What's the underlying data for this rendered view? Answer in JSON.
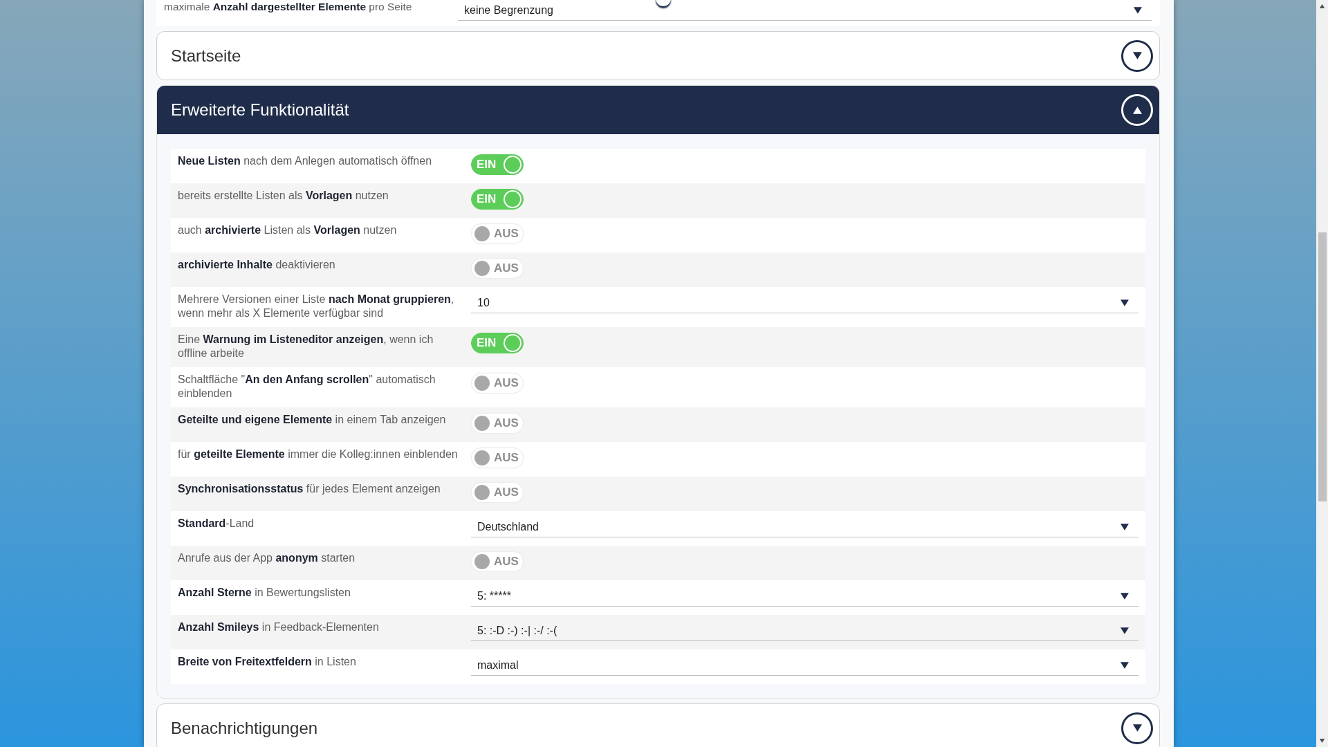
{
  "top_row": {
    "label": "maximale **Anzahl dargestellter Elemente** pro Seite",
    "value": "keine Begrenzung"
  },
  "sections": [
    {
      "title": "Startseite",
      "expanded": false
    },
    {
      "title": "Erweiterte Funktionalität",
      "expanded": true,
      "settings": [
        {
          "kind": "toggle",
          "label": "**Neue Listen** nach dem Anlegen automatisch öffnen",
          "on": true,
          "state_label": "EIN"
        },
        {
          "kind": "toggle",
          "label": "bereits erstellte Listen als **Vorlagen** nutzen",
          "on": true,
          "state_label": "EIN"
        },
        {
          "kind": "toggle",
          "label": "auch **archivierte** Listen als **Vorlagen** nutzen",
          "on": false,
          "state_label": "AUS"
        },
        {
          "kind": "toggle",
          "label": "**archivierte Inhalte** deaktivieren",
          "on": false,
          "state_label": "AUS"
        },
        {
          "kind": "select",
          "label": "Mehrere Versionen einer Liste **nach Monat gruppieren**, wenn mehr als X Elemente verfügbar sind",
          "value": "10"
        },
        {
          "kind": "toggle",
          "label": "Eine **Warnung im Listeneditor anzeigen**, wenn ich offline arbeite",
          "on": true,
          "state_label": "EIN"
        },
        {
          "kind": "toggle",
          "label": "Schaltfläche \"**An den Anfang scrollen**\" automatisch einblenden",
          "on": false,
          "state_label": "AUS"
        },
        {
          "kind": "toggle",
          "label": "**Geteilte und eigene Elemente** in einem Tab anzeigen",
          "on": false,
          "state_label": "AUS"
        },
        {
          "kind": "toggle",
          "label": "für **geteilte Elemente** immer die Kolleg:innen einblenden",
          "on": false,
          "state_label": "AUS"
        },
        {
          "kind": "toggle",
          "label": "**Synchronisationsstatus** für jedes Element anzeigen",
          "on": false,
          "state_label": "AUS"
        },
        {
          "kind": "select",
          "label": "**Standard**-Land",
          "value": "Deutschland"
        },
        {
          "kind": "toggle",
          "label": "Anrufe aus der App **anonym** starten",
          "on": false,
          "state_label": "AUS"
        },
        {
          "kind": "select",
          "label": "**Anzahl Sterne** in Bewertungslisten",
          "value": "5: *****"
        },
        {
          "kind": "select",
          "label": "**Anzahl Smileys** in Feedback-Elementen",
          "value": "5: :-D :-) :-| :-/ :-("
        },
        {
          "kind": "select",
          "label": "**Breite von Freitextfeldern** in Listen",
          "value": "maximal"
        }
      ]
    },
    {
      "title": "Benachrichtigungen",
      "expanded": false
    }
  ]
}
